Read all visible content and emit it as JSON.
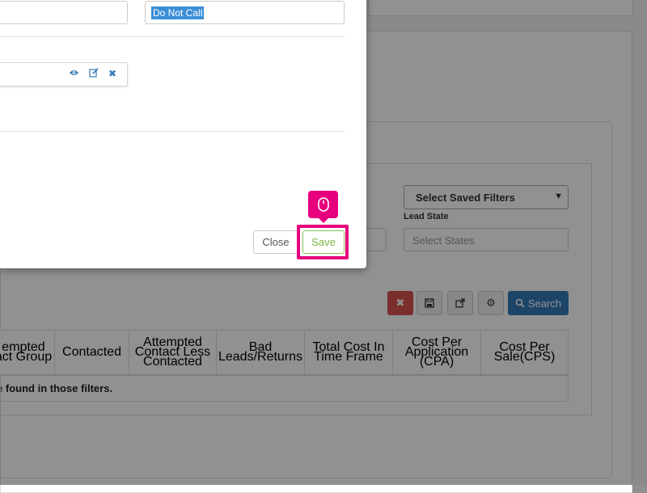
{
  "modal": {
    "right_field_value": "Do Not Call",
    "close_label": "Close",
    "save_label": "Save"
  },
  "background": {
    "saved_filters_select": "Select Saved Filters",
    "lead_state_label": "Lead State",
    "states_placeholder": "Select States",
    "search_label": "Search",
    "table_headers": [
      "empted\nact Group",
      "Contacted",
      "Attempted\nContact Less\nContacted",
      "Bad\nLeads/Returns",
      "Total Cost In\nTime Frame",
      "Cost Per\nApplication\n(CPA)",
      "Cost Per\nSale(CPS)"
    ],
    "no_results_text": "re found in those filters."
  },
  "colors": {
    "highlight": "#e6007e",
    "save_green": "#7cb342",
    "search_blue": "#337ab7",
    "clear_red": "#d9534f"
  },
  "icons": {
    "view": "eye-icon",
    "edit": "edit-icon",
    "delete": "close-icon",
    "pointer": "mouse-icon"
  }
}
